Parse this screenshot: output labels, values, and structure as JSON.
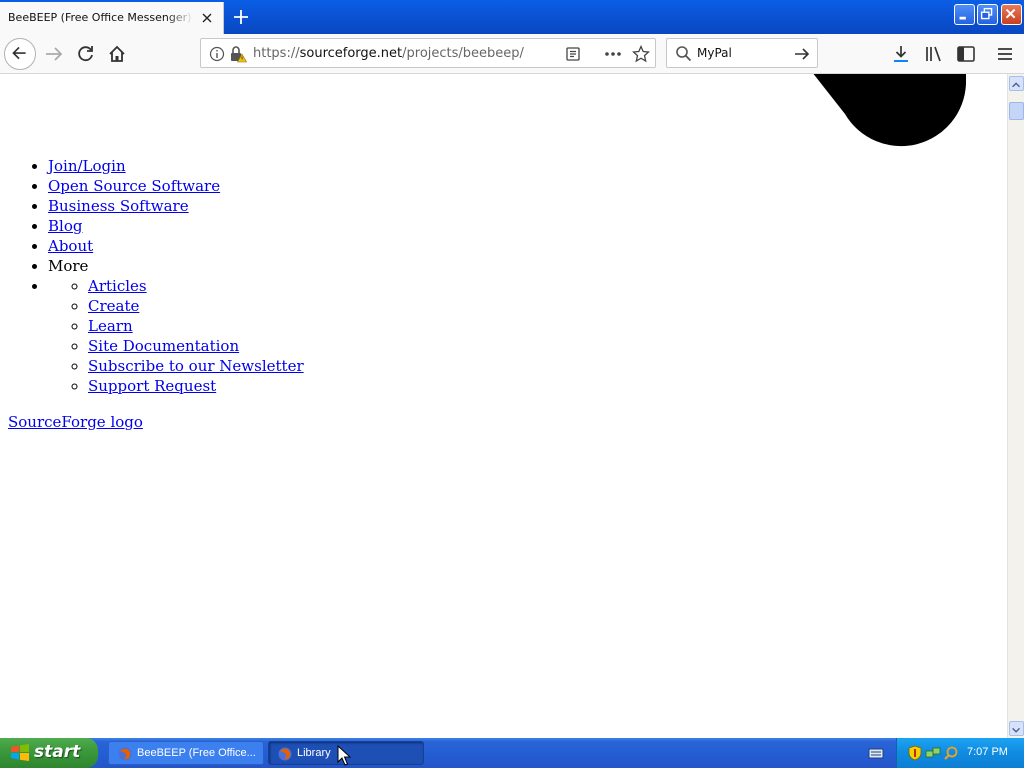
{
  "browser": {
    "tab_title": "BeeBEEP (Free Office Messenger) download | SourceForge.net",
    "url_prefix": "https://",
    "url_host": "sourceforge.net",
    "url_path": "/projects/beebeep/",
    "search_value": "MyPal"
  },
  "page": {
    "menu": [
      {
        "label": "Join/Login"
      },
      {
        "label": "Open Source Software"
      },
      {
        "label": "Business Software"
      },
      {
        "label": "Blog"
      },
      {
        "label": "About"
      },
      {
        "label": "More"
      }
    ],
    "submenu": [
      {
        "label": "Articles"
      },
      {
        "label": "Create"
      },
      {
        "label": "Learn"
      },
      {
        "label": "Site Documentation"
      },
      {
        "label": "Subscribe to our Newsletter"
      },
      {
        "label": "Support Request"
      }
    ],
    "logo_link": "SourceForge logo"
  },
  "taskbar": {
    "start_label": "start",
    "tasks": [
      {
        "label": "BeeBEEP (Free Office..."
      },
      {
        "label": "Library"
      }
    ],
    "clock": "7:07 PM"
  },
  "colors": {
    "link": "#0000ee",
    "titlebar": "#0b54d8",
    "start_button": "#3c9a3c"
  }
}
